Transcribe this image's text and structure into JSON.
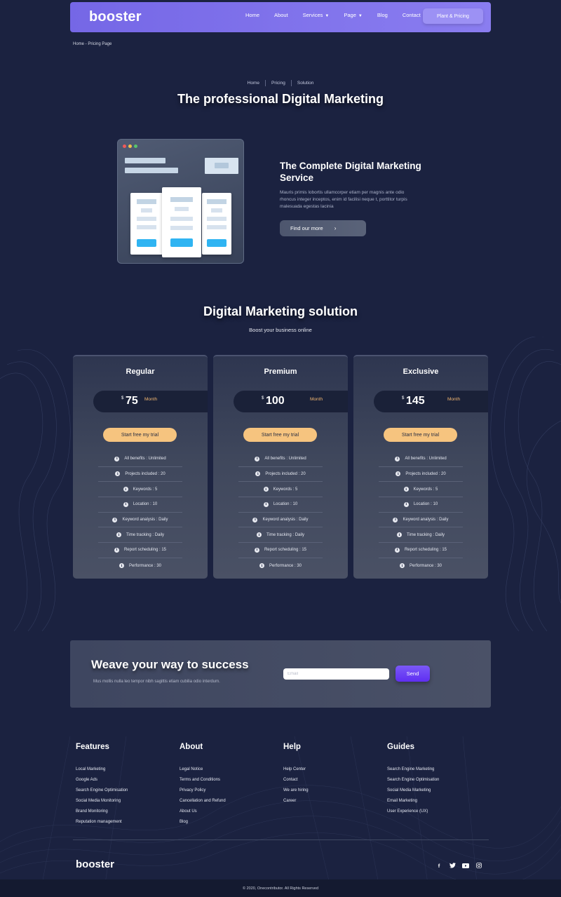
{
  "header": {
    "logo": "booster",
    "nav": [
      {
        "label": "Home",
        "dropdown": false
      },
      {
        "label": "About",
        "dropdown": false
      },
      {
        "label": "Services",
        "dropdown": true
      },
      {
        "label": "Page",
        "dropdown": true
      },
      {
        "label": "Blog",
        "dropdown": false
      },
      {
        "label": "Contact",
        "dropdown": false
      }
    ],
    "cta": "Plant & Pricing"
  },
  "top_breadcrumb": "Home - Pricing Page",
  "hero": {
    "breadcrumbs": [
      "Home",
      "Pricing",
      "Solution"
    ],
    "title": "The professional Digital Marketing"
  },
  "service": {
    "title": "The Complete Digital Marketing Service",
    "text": "Mauris primis lobortis ullamcorper etiam per magnis ante odio rhoncus integer inceptos, enim id facilisi neque t, porttitor turpis malesuada egestas lacinia",
    "button": "Find our more",
    "button_icon": "chevron-right-icon"
  },
  "pricing": {
    "title": "Digital Marketing solution",
    "subtitle": "Boost your business online",
    "plans": [
      {
        "name": "Regular",
        "currency": "$",
        "price": "75",
        "period": "Month",
        "button": "Start free my trial",
        "features": [
          "All benefits : Unlimited",
          "Projects included : 20",
          "Keywords : 5",
          "Location : 10",
          "Keyword analysis : Daily",
          "Time tracking : Daily",
          "Report scheduling : 15",
          "Performance : 30"
        ]
      },
      {
        "name": "Premium",
        "currency": "$",
        "price": "100",
        "period": "Month",
        "button": "Start free my trial",
        "features": [
          "All benefits : Unlimited",
          "Projects included : 20",
          "Keywords : 5",
          "Location : 10",
          "Keyword analysis : Daily",
          "Time tracking : Daily",
          "Report scheduling : 15",
          "Performance : 30"
        ]
      },
      {
        "name": "Exclusive",
        "currency": "$",
        "price": "145",
        "period": "Month",
        "button": "Start free my trial",
        "features": [
          "All benefits : Unlimited",
          "Projects included : 20",
          "Keywords : 5",
          "Location : 10",
          "Keyword analysis : Daily",
          "Time tracking : Daily",
          "Report scheduling : 15",
          "Performance : 30"
        ]
      }
    ]
  },
  "newsletter": {
    "title": "Weave your way to success",
    "text": "Mus mollis nulla leo tempor nibh sagittis etiam cubilia odio interdum.",
    "placeholder": "Email",
    "button": "Send"
  },
  "footer": {
    "columns": [
      {
        "title": "Features",
        "links": [
          "Local Marketing",
          "Google Ads",
          "Search Engine Optimisation",
          "Social Media Monitoring",
          "Brand Monitoring",
          "Reputation management"
        ]
      },
      {
        "title": "About",
        "links": [
          "Legal Notice",
          "Terms and Conditions",
          "Privacy Policy",
          "Cancellation and Refund",
          "About Us",
          "Blog"
        ]
      },
      {
        "title": "Help",
        "links": [
          "Help Center",
          "Contact",
          "We are hiring",
          "Career"
        ]
      },
      {
        "title": "Guides",
        "links": [
          "Search Engine Marketing",
          "Search Engine Optimisation",
          "Social Media Marketing",
          "Email Marketing",
          "User Experience (UX)"
        ]
      }
    ],
    "logo": "booster",
    "social": [
      "facebook-icon",
      "twitter-icon",
      "youtube-icon",
      "instagram-icon"
    ],
    "copyright": "© 2020, Onecontributor. All Rights Reserved"
  },
  "colors": {
    "background": "#1b2240",
    "nav": "#7567e6",
    "accent_orange": "#f6c47f",
    "send_purple": "#6a3ff4",
    "illustration_button": "#2fb4f2"
  }
}
